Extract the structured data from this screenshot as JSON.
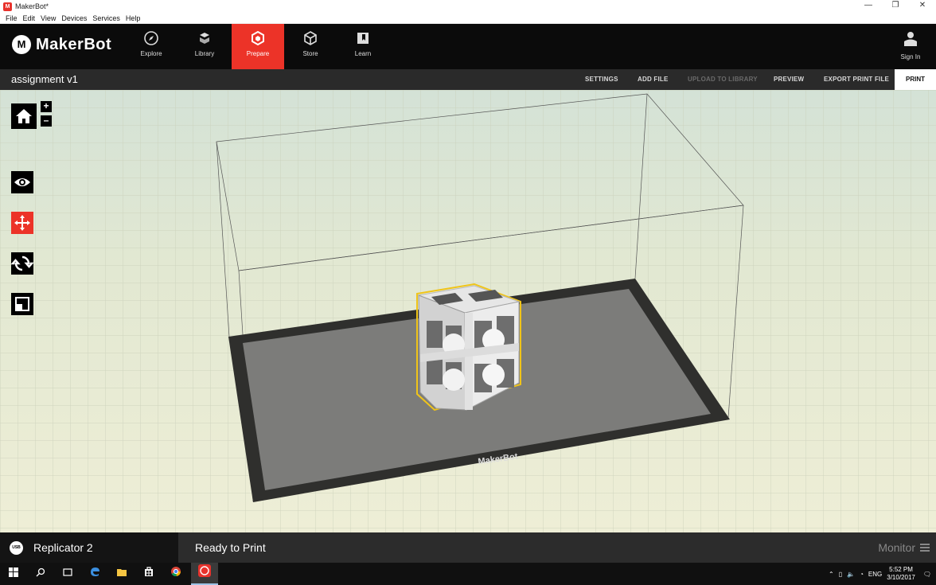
{
  "window": {
    "title": "MakerBot*",
    "controls": [
      "—",
      "❐",
      "✕"
    ]
  },
  "menu": [
    "File",
    "Edit",
    "View",
    "Devices",
    "Services",
    "Help"
  ],
  "brand": {
    "mark": "M",
    "name": "MakerBot",
    "accent": "#ec3328"
  },
  "nav": {
    "tabs": [
      {
        "label": "Explore",
        "icon": "compass-icon"
      },
      {
        "label": "Library",
        "icon": "library-icon"
      },
      {
        "label": "Prepare",
        "icon": "prepare-icon",
        "active": true
      },
      {
        "label": "Store",
        "icon": "store-box-icon"
      },
      {
        "label": "Learn",
        "icon": "learn-book-icon"
      }
    ],
    "sign_in": "Sign In"
  },
  "project": {
    "name": "assignment v1",
    "actions": {
      "settings": "SETTINGS",
      "add_file": "ADD FILE",
      "upload": "UPLOAD TO LIBRARY",
      "preview": "PREVIEW",
      "export": "EXPORT PRINT FILE",
      "print": "PRINT"
    }
  },
  "viewport": {
    "zoom_in": "+",
    "zoom_out": "–",
    "plate_brand": "MakerBot",
    "tools": [
      "home-icon",
      "eye-icon",
      "move-icon",
      "rotate-icon",
      "scale-icon"
    ],
    "active_tool": "move-icon"
  },
  "status": {
    "connection": "USB",
    "printer": "Replicator 2",
    "state": "Ready to Print",
    "monitor": "Monitor"
  },
  "taskbar": {
    "time": "5:52 PM",
    "date": "3/10/2017",
    "lang": "ENG"
  }
}
